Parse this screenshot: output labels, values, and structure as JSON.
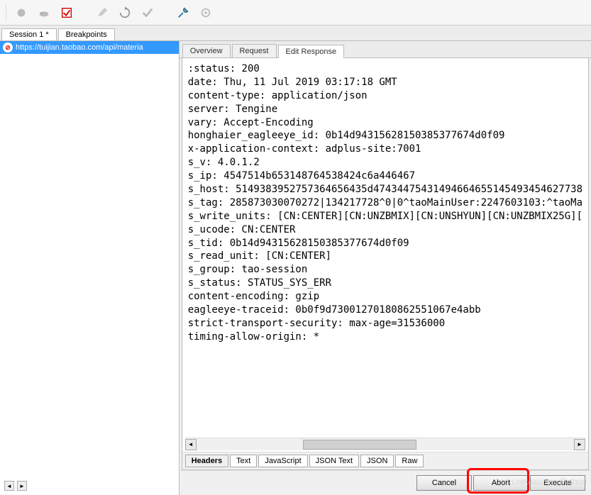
{
  "toolbar": {
    "icons": [
      "circle",
      "turtle",
      "checkbox",
      "pen",
      "refresh",
      "check",
      "wrench",
      "gear"
    ]
  },
  "sessionTabs": {
    "items": [
      {
        "label": "Session 1 *"
      },
      {
        "label": "Breakpoints"
      }
    ]
  },
  "urlList": {
    "items": [
      {
        "icon": "stop",
        "url": "https://tuijian.taobao.com/api/materia"
      }
    ]
  },
  "topTabs": {
    "items": [
      {
        "label": "Overview",
        "active": false
      },
      {
        "label": "Request",
        "active": false
      },
      {
        "label": "Edit Response",
        "active": true
      }
    ]
  },
  "headers": [
    ":status: 200",
    "date: Thu, 11 Jul 2019 03:17:18 GMT",
    "content-type: application/json",
    "server: Tengine",
    "vary: Accept-Encoding",
    "honghaier_eagleeye_id: 0b14d94315628150385377674d0f09",
    "x-application-context: adplus-site:7001",
    "s_v: 4.0.1.2",
    "s_ip: 4547514b653148764538424c6a446467",
    "s_host: 5149383952757364656435d47434475431494664655145493454627738",
    "s_tag: 285873030070272|134217728^0|0^taoMainUser:2247603103:^taoMa",
    "s_write_units: [CN:CENTER][CN:UNZBMIX][CN:UNSHYUN][CN:UNZBMIX25G][",
    "s_ucode: CN:CENTER",
    "s_tid: 0b14d94315628150385377674d0f09",
    "s_read_unit: [CN:CENTER]",
    "s_group: tao-session",
    "s_status: STATUS_SYS_ERR",
    "content-encoding: gzip",
    "eagleeye-traceid: 0b0f9d73001270180862551067e4abb",
    "strict-transport-security: max-age=31536000",
    "timing-allow-origin: *"
  ],
  "bottomTabs": {
    "items": [
      {
        "label": "Headers",
        "active": true
      },
      {
        "label": "Text"
      },
      {
        "label": "JavaScript"
      },
      {
        "label": "JSON Text"
      },
      {
        "label": "JSON"
      },
      {
        "label": "Raw"
      }
    ]
  },
  "actions": {
    "cancel": "Cancel",
    "abort": "Abort",
    "execute": "Execute"
  },
  "watermark": "csdn.net/laozhu_Python"
}
